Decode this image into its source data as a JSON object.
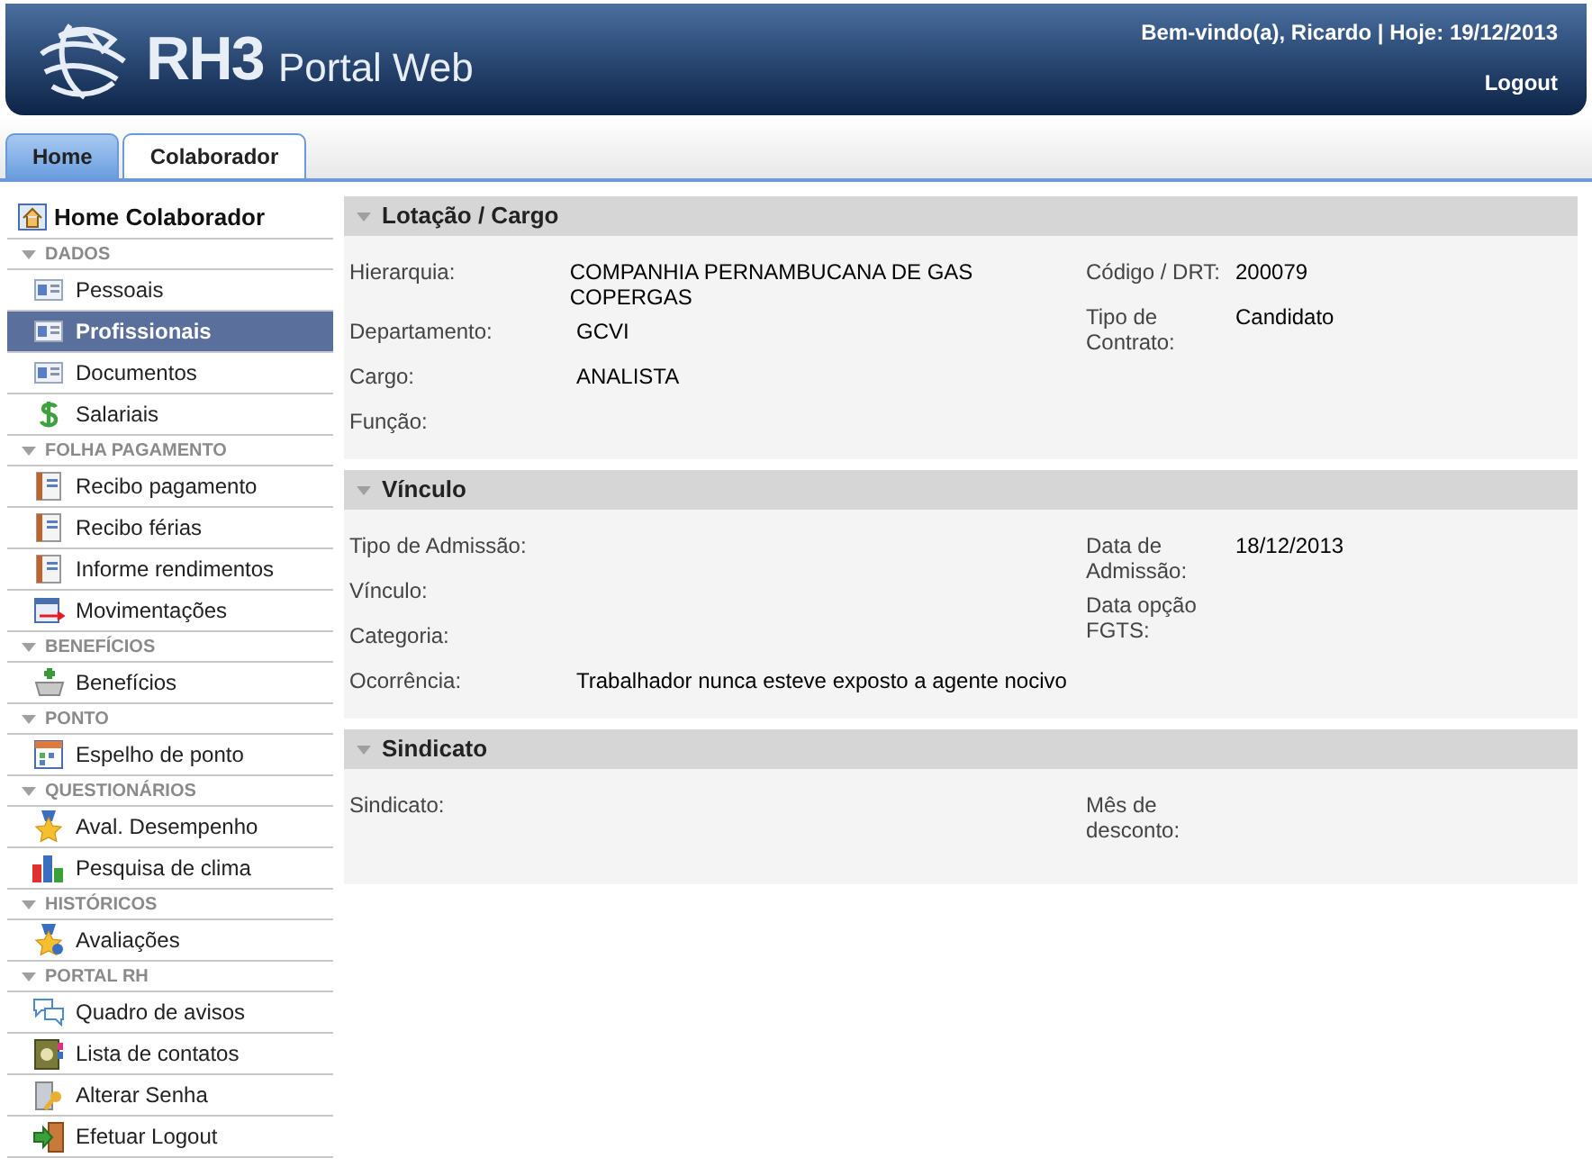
{
  "header": {
    "logo_mark": "RH3",
    "logo_text": "Portal Web",
    "welcome": "Bem-vindo(a), Ricardo | Hoje: 19/12/2013",
    "logout": "Logout"
  },
  "tabs": [
    {
      "label": "Home",
      "selected": false
    },
    {
      "label": "Colaborador",
      "selected": true
    }
  ],
  "sidebar": {
    "home": "Home Colaborador",
    "groups": [
      {
        "title": "DADOS",
        "items": [
          {
            "label": "Pessoais",
            "selected": false
          },
          {
            "label": "Profissionais",
            "selected": true
          },
          {
            "label": "Documentos",
            "selected": false
          },
          {
            "label": "Salariais",
            "selected": false
          }
        ]
      },
      {
        "title": "FOLHA PAGAMENTO",
        "items": [
          {
            "label": "Recibo pagamento",
            "selected": false
          },
          {
            "label": "Recibo férias",
            "selected": false
          },
          {
            "label": "Informe rendimentos",
            "selected": false
          },
          {
            "label": "Movimentações",
            "selected": false
          }
        ]
      },
      {
        "title": "BENEFÍCIOS",
        "items": [
          {
            "label": "Benefícios",
            "selected": false
          }
        ]
      },
      {
        "title": "PONTO",
        "items": [
          {
            "label": "Espelho de ponto",
            "selected": false
          }
        ]
      },
      {
        "title": "QUESTIONÁRIOS",
        "items": [
          {
            "label": "Aval. Desempenho",
            "selected": false
          },
          {
            "label": "Pesquisa de clima",
            "selected": false
          }
        ]
      },
      {
        "title": "HISTÓRICOS",
        "items": [
          {
            "label": "Avaliações",
            "selected": false
          }
        ]
      },
      {
        "title": "PORTAL RH",
        "items": [
          {
            "label": "Quadro de avisos",
            "selected": false
          },
          {
            "label": "Lista de contatos",
            "selected": false
          },
          {
            "label": "Alterar Senha",
            "selected": false
          },
          {
            "label": "Efetuar Logout",
            "selected": false
          }
        ]
      }
    ]
  },
  "sections": [
    {
      "title": "Lotação / Cargo",
      "left": [
        {
          "label": "Hierarquia:",
          "value": "COMPANHIA PERNAMBUCANA DE GAS COPERGAS"
        },
        {
          "label": "Departamento:",
          "value": "GCVI"
        },
        {
          "label": "Cargo:",
          "value": "ANALISTA"
        },
        {
          "label": "Função:"
        }
      ],
      "right": [
        {
          "label": "Código / DRT:",
          "value": "200079"
        },
        {
          "label": "Tipo de Contrato:",
          "value": "Candidato"
        }
      ]
    },
    {
      "title": "Vínculo",
      "left": [
        {
          "label": "Tipo de Admissão:"
        },
        {
          "label": "Vínculo:"
        },
        {
          "label": "Categoria:"
        },
        {
          "label": "Ocorrência:",
          "value": "Trabalhador nunca esteve exposto a agente nocivo"
        }
      ],
      "right": [
        {
          "label": "Data de Admissão:",
          "value": "18/12/2013"
        },
        {
          "label": "Data opção FGTS:"
        }
      ]
    },
    {
      "title": "Sindicato",
      "left": [
        {
          "label": "Sindicato:"
        }
      ],
      "right": [
        {
          "label": "Mês de desconto:"
        }
      ]
    }
  ]
}
